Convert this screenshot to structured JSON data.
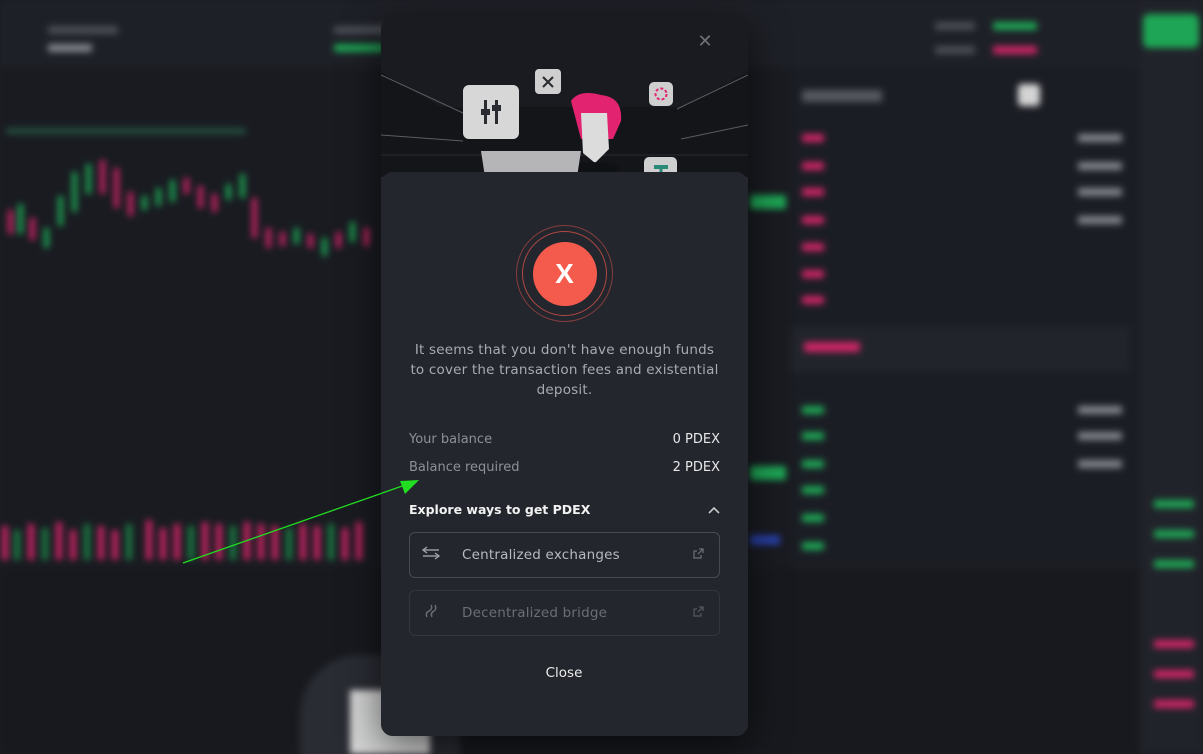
{
  "modal": {
    "message": "It seems that you don't have enough funds to cover the transaction fees and existential deposit.",
    "balance": {
      "your_label": "Your balance",
      "your_value": "0 PDEX",
      "required_label": "Balance required",
      "required_value": "2 PDEX"
    },
    "explore_title": "Explore ways to get PDEX",
    "options": [
      {
        "label": "Centralized exchanges",
        "icon": "arrows-swap-icon",
        "enabled": true
      },
      {
        "label": "Decentralized bridge",
        "icon": "bridge-icon",
        "enabled": false
      }
    ],
    "close_label": "Close",
    "status_glyph": "X"
  },
  "colors": {
    "error": "#f55b4d",
    "annotation_arrow": "#22dd22",
    "accent_green": "#1fb45b"
  }
}
